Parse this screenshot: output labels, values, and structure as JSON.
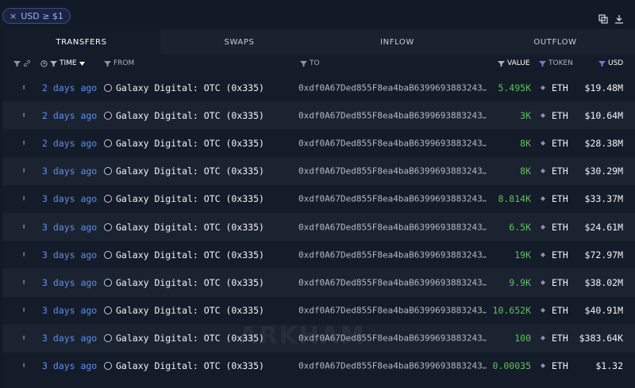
{
  "filter": {
    "label": "USD ≥ $1",
    "close": "×"
  },
  "tabs": [
    {
      "label": "TRANSFERS"
    },
    {
      "label": "SWAPS"
    },
    {
      "label": "INFLOW"
    },
    {
      "label": "OUTFLOW"
    }
  ],
  "headers": {
    "time": "TIME",
    "from": "FROM",
    "to": "TO",
    "value": "VALUE",
    "token": "TOKEN",
    "usd": "USD"
  },
  "rows": [
    {
      "time": "2 days ago",
      "from": "Galaxy Digital: OTC (0x335)",
      "to": "0xdf0A67Ded855F8ea4baB6399693883243…",
      "value": "5.495K",
      "token": "ETH",
      "usd": "$19.48M"
    },
    {
      "time": "2 days ago",
      "from": "Galaxy Digital: OTC (0x335)",
      "to": "0xdf0A67Ded855F8ea4baB6399693883243…",
      "value": "3K",
      "token": "ETH",
      "usd": "$10.64M"
    },
    {
      "time": "2 days ago",
      "from": "Galaxy Digital: OTC (0x335)",
      "to": "0xdf0A67Ded855F8ea4baB6399693883243…",
      "value": "8K",
      "token": "ETH",
      "usd": "$28.38M"
    },
    {
      "time": "3 days ago",
      "from": "Galaxy Digital: OTC (0x335)",
      "to": "0xdf0A67Ded855F8ea4baB6399693883243…",
      "value": "8K",
      "token": "ETH",
      "usd": "$30.29M"
    },
    {
      "time": "3 days ago",
      "from": "Galaxy Digital: OTC (0x335)",
      "to": "0xdf0A67Ded855F8ea4baB6399693883243…",
      "value": "8.814K",
      "token": "ETH",
      "usd": "$33.37M"
    },
    {
      "time": "3 days ago",
      "from": "Galaxy Digital: OTC (0x335)",
      "to": "0xdf0A67Ded855F8ea4baB6399693883243…",
      "value": "6.5K",
      "token": "ETH",
      "usd": "$24.61M"
    },
    {
      "time": "3 days ago",
      "from": "Galaxy Digital: OTC (0x335)",
      "to": "0xdf0A67Ded855F8ea4baB6399693883243…",
      "value": "19K",
      "token": "ETH",
      "usd": "$72.97M"
    },
    {
      "time": "3 days ago",
      "from": "Galaxy Digital: OTC (0x335)",
      "to": "0xdf0A67Ded855F8ea4baB6399693883243…",
      "value": "9.9K",
      "token": "ETH",
      "usd": "$38.02M"
    },
    {
      "time": "3 days ago",
      "from": "Galaxy Digital: OTC (0x335)",
      "to": "0xdf0A67Ded855F8ea4baB6399693883243…",
      "value": "10.652K",
      "token": "ETH",
      "usd": "$40.91M"
    },
    {
      "time": "3 days ago",
      "from": "Galaxy Digital: OTC (0x335)",
      "to": "0xdf0A67Ded855F8ea4baB6399693883243…",
      "value": "100",
      "token": "ETH",
      "usd": "$383.64K"
    },
    {
      "time": "3 days ago",
      "from": "Galaxy Digital: OTC (0x335)",
      "to": "0xdf0A67Ded855F8ea4baB6399693883243…",
      "value": "0.00035",
      "token": "ETH",
      "usd": "$1.32"
    }
  ],
  "watermark": "ARKHAM",
  "colors": {
    "background": "#121a27",
    "time_link": "#5d8ff0",
    "value_green": "#5ec25e",
    "token_accent": "#7f6fe0"
  },
  "icons": [
    "filter-icon",
    "link-icon",
    "clock-icon",
    "sort-down-icon",
    "copy-icon",
    "download-icon",
    "eth-icon",
    "direction-icon",
    "entity-icon"
  ]
}
